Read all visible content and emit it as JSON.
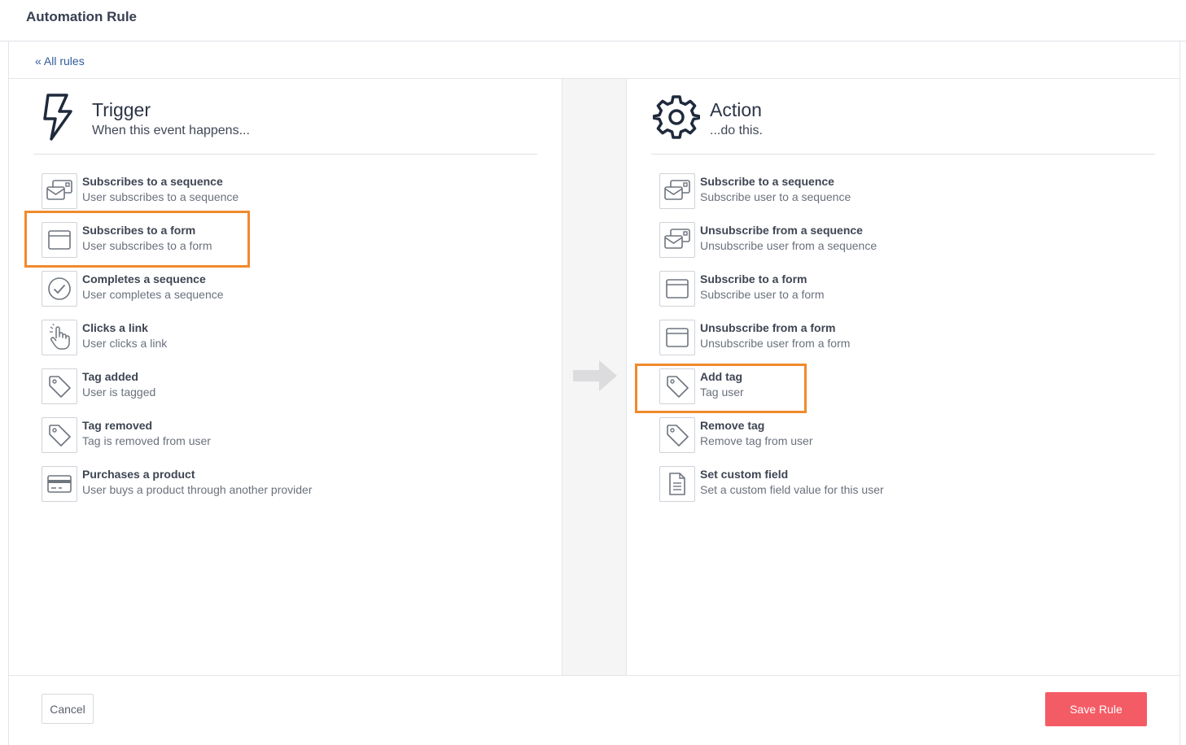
{
  "header": {
    "title": "Automation Rule"
  },
  "nav": {
    "back_link": "« All rules"
  },
  "trigger": {
    "title": "Trigger",
    "subtitle": "When this event happens...",
    "items": [
      {
        "title": "Subscribes to a sequence",
        "desc": "User subscribes to a sequence",
        "icon": "sequence-envelope-icon"
      },
      {
        "title": "Subscribes to a form",
        "desc": "User subscribes to a form",
        "icon": "form-window-icon",
        "highlighted": true
      },
      {
        "title": "Completes a sequence",
        "desc": "User completes a sequence",
        "icon": "check-circle-icon"
      },
      {
        "title": "Clicks a link",
        "desc": "User clicks a link",
        "icon": "pointer-hand-icon"
      },
      {
        "title": "Tag added",
        "desc": "User is tagged",
        "icon": "tag-icon"
      },
      {
        "title": "Tag removed",
        "desc": "Tag is removed from user",
        "icon": "tag-icon"
      },
      {
        "title": "Purchases a product",
        "desc": "User buys a product through another provider",
        "icon": "credit-card-icon"
      }
    ]
  },
  "action": {
    "title": "Action",
    "subtitle": "...do this.",
    "items": [
      {
        "title": "Subscribe to a sequence",
        "desc": "Subscribe user to a sequence",
        "icon": "sequence-envelope-icon"
      },
      {
        "title": "Unsubscribe from a sequence",
        "desc": "Unsubscribe user from a sequence",
        "icon": "sequence-envelope-icon"
      },
      {
        "title": "Subscribe to a form",
        "desc": "Subscribe user to a form",
        "icon": "form-window-icon"
      },
      {
        "title": "Unsubscribe from a form",
        "desc": "Unsubscribe user from a form",
        "icon": "form-window-icon"
      },
      {
        "title": "Add tag",
        "desc": "Tag user",
        "icon": "tag-icon",
        "highlighted": true
      },
      {
        "title": "Remove tag",
        "desc": "Remove tag from user",
        "icon": "tag-icon"
      },
      {
        "title": "Set custom field",
        "desc": "Set a custom field value for this user",
        "icon": "document-icon"
      }
    ]
  },
  "footer": {
    "cancel_label": "Cancel",
    "save_label": "Save Rule"
  },
  "colors": {
    "accent": "#f45c65",
    "highlight": "#f08a2c",
    "link": "#2f5b9b"
  }
}
